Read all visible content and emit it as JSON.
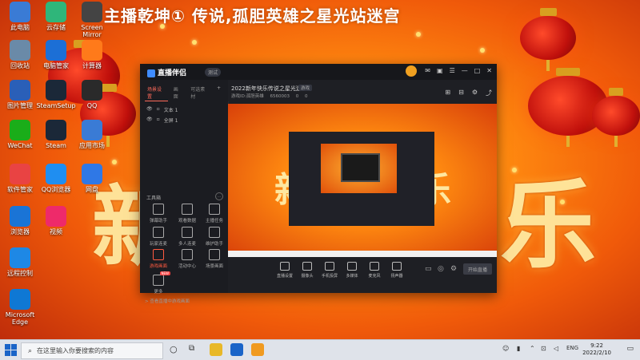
{
  "stream_title": "主播乾坤① 传说,孤胆英雄之星光站迷宫",
  "background": {
    "chars": [
      "新",
      "乐"
    ]
  },
  "desktop_icons": [
    {
      "label": "此电脑",
      "icon": "computer-icon",
      "color": "#3a7bd5"
    },
    {
      "label": "云存储",
      "icon": "cloud-icon",
      "color": "#2fb67a"
    },
    {
      "label": "Screen Mirror",
      "icon": "mirror-icon",
      "color": "#444"
    },
    {
      "label": "回收站",
      "icon": "trash-icon",
      "color": "#6a8aa8"
    },
    {
      "label": "电脑管家",
      "icon": "shield-icon",
      "color": "#1c6fd6"
    },
    {
      "label": "计算器",
      "icon": "calc-icon",
      "color": "#ff7a1a"
    },
    {
      "label": "图片管理",
      "icon": "image-icon",
      "color": "#2a5fb8"
    },
    {
      "label": "SteamSetup",
      "icon": "steam-icon",
      "color": "#1b2838"
    },
    {
      "label": "QQ",
      "icon": "qq-icon",
      "color": "#2a2a2a"
    },
    {
      "label": "WeChat",
      "icon": "wechat-icon",
      "color": "#1aad19"
    },
    {
      "label": "Steam",
      "icon": "steam-icon",
      "color": "#1b2838"
    },
    {
      "label": "应用市场",
      "icon": "store-icon",
      "color": "#3a7bd5"
    },
    {
      "label": "软件管家",
      "icon": "apps-icon",
      "color": "#e94343"
    },
    {
      "label": "QQ浏览器",
      "icon": "browser-icon",
      "color": "#1f8ef1"
    },
    {
      "label": "网盘",
      "icon": "drive-icon",
      "color": "#2f78e6"
    },
    {
      "label": "浏览器",
      "icon": "ie-icon",
      "color": "#1a74d6"
    },
    {
      "label": "视频",
      "icon": "video-icon",
      "color": "#ee2a6a"
    },
    {
      "label": "远程控制",
      "icon": "remote-icon",
      "color": "#1e88e5"
    },
    {
      "label": "Microsoft Edge",
      "icon": "edge-icon",
      "color": "#0f78d4"
    }
  ],
  "app": {
    "logo": "直播伴侣",
    "version_badge": "测试",
    "tabs": [
      "场景设置",
      "画面",
      "可选素材"
    ],
    "active_tab": 0,
    "scenes": [
      {
        "name": "文本 1"
      },
      {
        "name": "全屏 1"
      }
    ],
    "tools_title": "工具箱",
    "tools": [
      {
        "label": "弹幕助手"
      },
      {
        "label": "观看数据"
      },
      {
        "label": "主播任务"
      },
      {
        "label": "玩家连麦"
      },
      {
        "label": "多人连麦"
      },
      {
        "label": "维护助手"
      },
      {
        "label": "游戏画面"
      },
      {
        "label": "活动中心"
      },
      {
        "label": "场景画面"
      },
      {
        "label": "更多",
        "tag": "NEW"
      }
    ],
    "promo": "> 查看直播中游戏画面",
    "room": {
      "title": "2022新年快乐传说之星光迷宫",
      "tag": "游戏",
      "sub": [
        "游戏ID:孤胆英雄",
        "6560003",
        "0",
        "0"
      ]
    },
    "bottom_actions": [
      {
        "label": "直播设置",
        "icon": "screen-icon"
      },
      {
        "label": "摄像头",
        "icon": "camera-icon"
      },
      {
        "label": "手机投屏",
        "icon": "phone-icon"
      },
      {
        "label": "多媒体",
        "icon": "media-icon"
      },
      {
        "label": "麦克风",
        "icon": "mic-icon"
      },
      {
        "label": "扬声器",
        "icon": "speaker-icon"
      }
    ],
    "start_button": "开始直播"
  },
  "taskbar": {
    "search_placeholder": "在这里输入你要搜索的内容",
    "time": "9:22",
    "date": "2022/2/10",
    "lang": "ENG"
  }
}
